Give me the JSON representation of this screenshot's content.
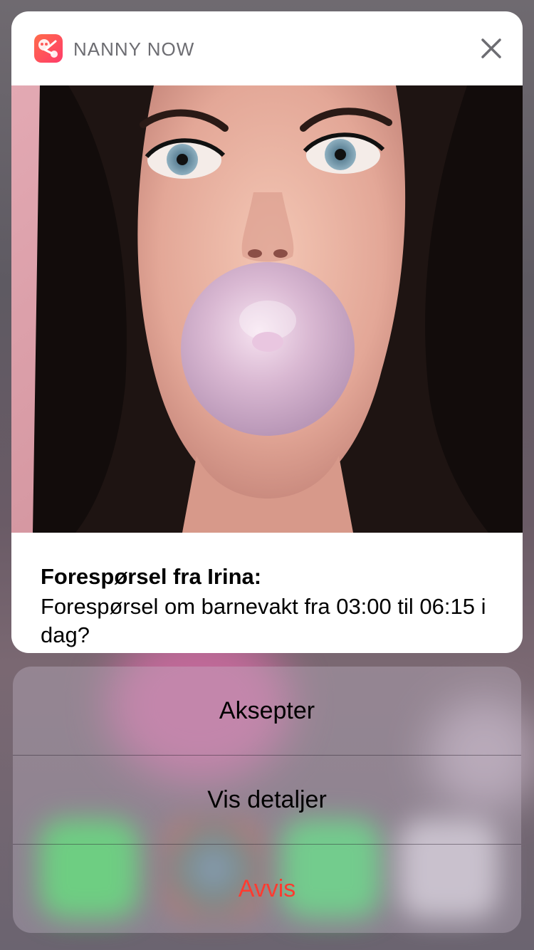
{
  "notification": {
    "app_name": "NANNY NOW",
    "app_icon": "nanny-now-app-icon",
    "close_icon": "close-icon",
    "title": "Forespørsel fra Irina:",
    "message": "Forespørsel om barnevakt fra 03:00 til 06:15 i dag?",
    "image": "profile-photo"
  },
  "actions": [
    {
      "label": "Aksepter"
    },
    {
      "label": "Vis detaljer"
    },
    {
      "label": "Avvis",
      "color": "#ff3b30"
    }
  ]
}
